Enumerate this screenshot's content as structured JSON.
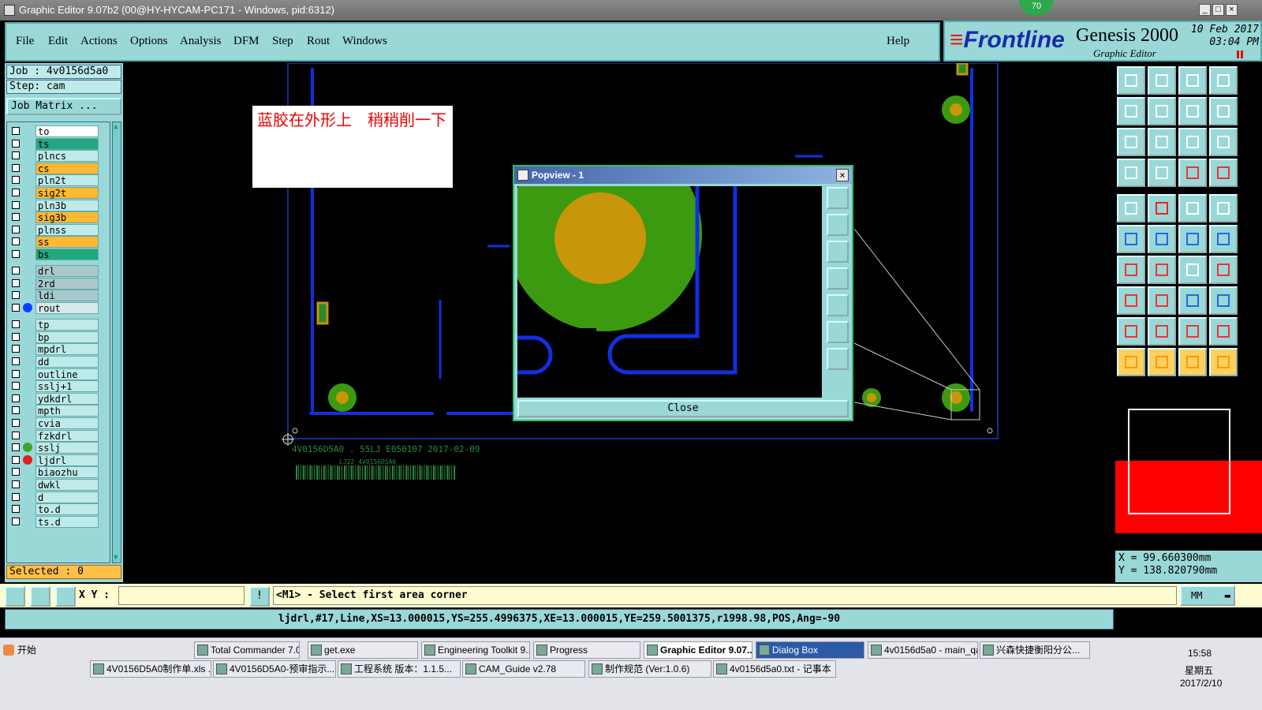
{
  "window": {
    "title": "Graphic Editor 9.07b2 (00@HY-HYCAM-PC171 - Windows, pid:6312)",
    "badge": "70"
  },
  "menu": {
    "items": [
      "File",
      "Edit",
      "Actions",
      "Options",
      "Analysis",
      "DFM",
      "Step",
      "Rout",
      "Windows"
    ],
    "help": "Help"
  },
  "brand": {
    "frontline": "Frontline",
    "product": "Genesis 2000",
    "subtitle": "Graphic Editor",
    "date": "10 Feb 2017",
    "time": "03:04 PM"
  },
  "left": {
    "job": "Job : 4v0156d5a0",
    "step": "Step: cam",
    "job_matrix": "Job Matrix ...",
    "selected": "Selected : 0",
    "layers": [
      {
        "name": "to",
        "color": "#ffffff"
      },
      {
        "name": "ts",
        "color": "#22a880"
      },
      {
        "name": "plncs",
        "color": "#bfeaea"
      },
      {
        "name": "cs",
        "color": "#ffb830"
      },
      {
        "name": "pln2t",
        "color": "#bfeaea"
      },
      {
        "name": "sig2t",
        "color": "#ffb830"
      },
      {
        "name": "pln3b",
        "color": "#bfeaea"
      },
      {
        "name": "sig3b",
        "color": "#ffb830"
      },
      {
        "name": "plnss",
        "color": "#bfeaea"
      },
      {
        "name": "ss",
        "color": "#ffb830"
      },
      {
        "name": "bs",
        "color": "#22a880"
      },
      {
        "name": "drl",
        "color": "#a8c8cc"
      },
      {
        "name": "2rd",
        "color": "#a8c8cc"
      },
      {
        "name": "ldi",
        "color": "#a8c8cc"
      },
      {
        "name": "rout",
        "color": "#d8e8ea",
        "dot": "#1040ff"
      },
      {
        "name": "tp",
        "color": "#bfeaea"
      },
      {
        "name": "bp",
        "color": "#bfeaea"
      },
      {
        "name": "mpdrl",
        "color": "#bfeaea"
      },
      {
        "name": "dd",
        "color": "#bfeaea"
      },
      {
        "name": "outline",
        "color": "#bfeaea"
      },
      {
        "name": "sslj+1",
        "color": "#bfeaea"
      },
      {
        "name": "ydkdrl",
        "color": "#bfeaea"
      },
      {
        "name": "mpth",
        "color": "#bfeaea"
      },
      {
        "name": "cvia",
        "color": "#bfeaea"
      },
      {
        "name": "fzkdrl",
        "color": "#bfeaea"
      },
      {
        "name": "sslj",
        "color": "#bfeaea",
        "dot": "#3aa830"
      },
      {
        "name": "ljdrl",
        "color": "#bfeaea",
        "dot": "#e02020"
      },
      {
        "name": "biaozhu",
        "color": "#bfeaea"
      },
      {
        "name": "dwkl",
        "color": "#bfeaea"
      },
      {
        "name": "d",
        "color": "#bfeaea"
      },
      {
        "name": "to.d",
        "color": "#bfeaea"
      },
      {
        "name": "ts.d",
        "color": "#bfeaea"
      }
    ]
  },
  "canvas": {
    "note": "蓝胶在外形上　稍稍削一下",
    "silk_text": "4V0156D5A0 . 55LJ E050107 2017-02-09",
    "silk_small": "LJ22 4V0156D5A0"
  },
  "popview": {
    "title": "Popview - 1",
    "close_label": "Close"
  },
  "right": {
    "coord_x": "X = 99.660300mm",
    "coord_y": "Y = 138.820790mm"
  },
  "command": {
    "xy_label": "X Y :",
    "xy_value": "",
    "message": "<M1> - Select first area corner",
    "units": "MM"
  },
  "status": {
    "text": "ljdrl,#17,Line,XS=13.000015,YS=255.4996375,XE=13.000015,YE=259.5001375,r1998.98,POS,Ang=-90"
  },
  "taskbar": {
    "start": "开始",
    "row1": [
      "Total Commander 7.0...",
      "get.exe",
      "Engineering Toolkit 9....",
      "Progress",
      "Graphic Editor 9.07...",
      "Dialog Box",
      "4v0156d5a0 - main_qa",
      "兴森快捷衡阳分公..."
    ],
    "row2": [
      "4V0156D5A0制作单.xls ...",
      "4V0156D5A0-预审指示...",
      "工程系统  版本：1.1.5...",
      "CAM_Guide v2.78",
      "制作规范 (Ver:1.0.6)",
      "4v0156d5a0.txt - 记事本"
    ],
    "clock": "15:58",
    "weekday": "星期五",
    "date": "2017/2/10"
  }
}
